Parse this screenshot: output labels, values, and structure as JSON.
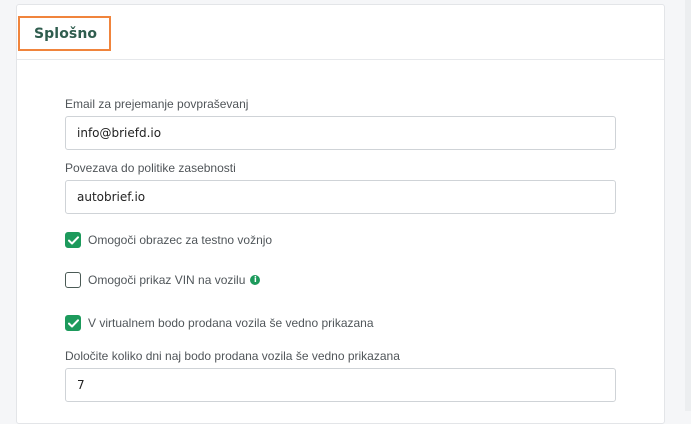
{
  "section": {
    "title": "Splošno"
  },
  "fields": {
    "email": {
      "label": "Email za prejemanje povpraševanj",
      "value": "info@briefd.io"
    },
    "privacy": {
      "label": "Povezava do politike zasebnosti",
      "value": "autobrief.io"
    },
    "days": {
      "label": "Določite koliko dni naj bodo prodana vozila še vedno prikazana",
      "value": "7"
    }
  },
  "options": {
    "test_drive": {
      "label": "Omogoči obrazec za testno vožnjo",
      "checked": true
    },
    "vin": {
      "label": "Omogoči prikaz VIN na vozilu",
      "checked": false,
      "info_icon": "info-icon"
    },
    "sold_shown": {
      "label": "V virtualnem bodo prodana vozila še vedno prikazana",
      "checked": true
    }
  },
  "colors": {
    "accent_green": "#1d9a5c",
    "highlight_orange": "#f0843c",
    "title_color": "#2f5d4e"
  }
}
